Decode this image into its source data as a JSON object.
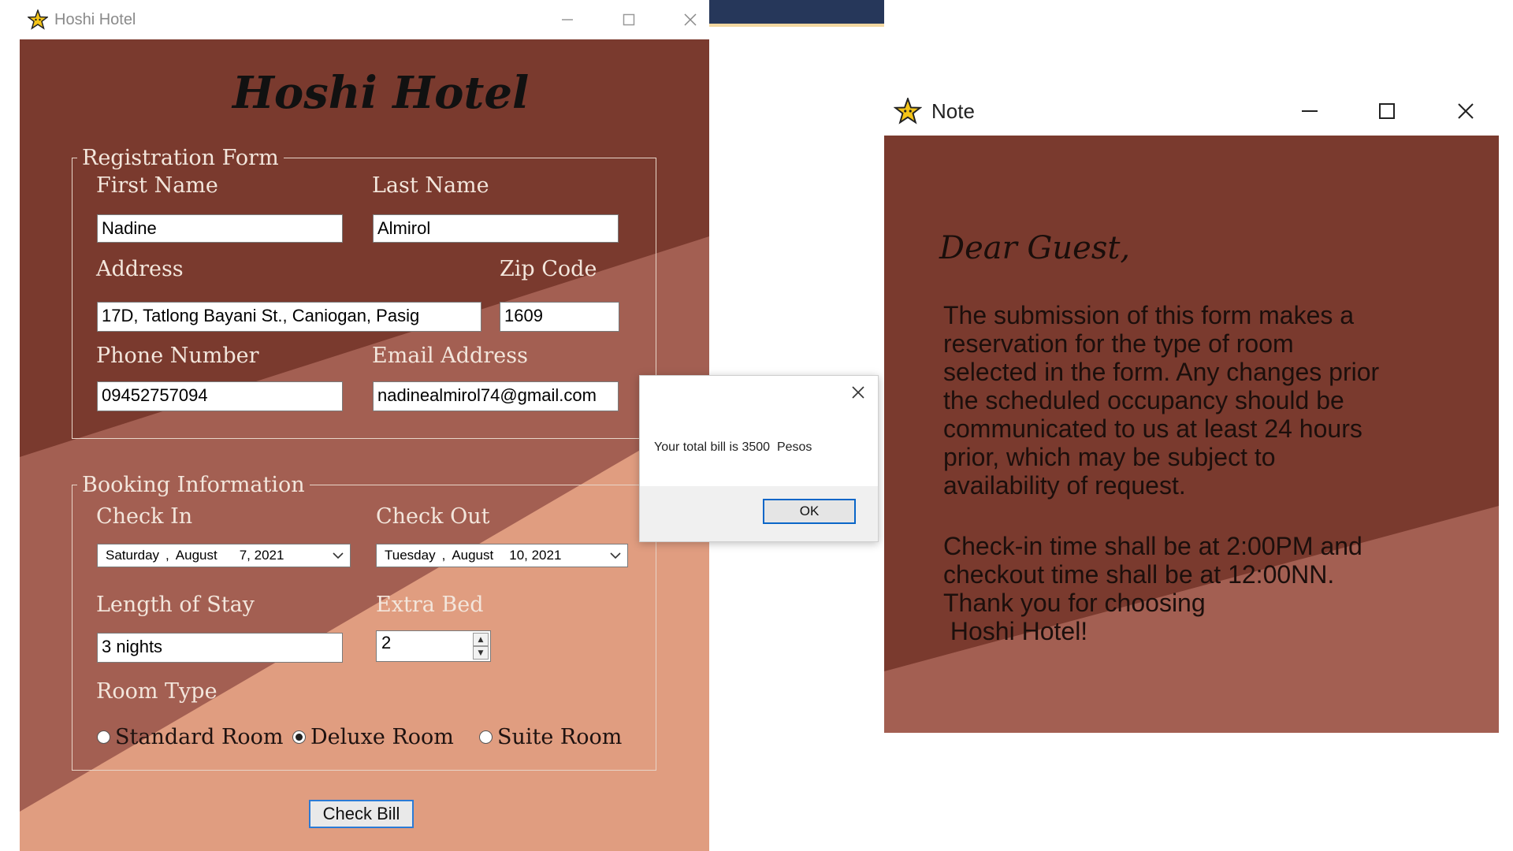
{
  "colors": {
    "dark_brown": "#7a3a2e",
    "mid_brown": "#a35f52",
    "peach": "#e09d80",
    "button_border": "#2b7bd6"
  },
  "main_window": {
    "title": "Hoshi Hotel",
    "icon": "star-icon",
    "heading": "Hoshi Hotel",
    "registration": {
      "legend": "Registration Form",
      "first_name_label": "First Name",
      "first_name": "Nadine",
      "last_name_label": "Last Name",
      "last_name": "Almirol",
      "address_label": "Address",
      "address": "17D, Tatlong Bayani St., Caniogan, Pasig",
      "zip_label": "Zip Code",
      "zip": "1609",
      "phone_label": "Phone Number",
      "phone": "09452757094",
      "email_label": "Email Address",
      "email": "nadinealmirol74@gmail.com"
    },
    "booking": {
      "legend": "Booking Information",
      "check_in_label": "Check In",
      "check_in": {
        "weekday": "Saturday",
        "month": "August",
        "day_year": "7, 2021"
      },
      "check_out_label": "Check Out",
      "check_out": {
        "weekday": "Tuesday",
        "month": "August",
        "day_year": "10, 2021"
      },
      "length_label": "Length of Stay",
      "length": "3 nights",
      "extra_bed_label": "Extra Bed",
      "extra_bed": "2",
      "room_type_label": "Room Type",
      "rooms": [
        "Standard Room",
        "Deluxe Room",
        "Suite Room"
      ],
      "selected_room": "Deluxe Room"
    },
    "check_bill_label": "Check Bill"
  },
  "dialog": {
    "message": "Your total bill is 3500  Pesos",
    "ok_label": "OK"
  },
  "note_window": {
    "title": "Note",
    "icon": "star-icon",
    "greeting": "Dear Guest,",
    "paragraph1": "The submission of this form makes a\nreservation for the type of room\nselected in the form. Any changes prior\nthe scheduled occupancy should be\ncommunicated to us at least 24 hours\nprior, which may be subject to\navailability of request.",
    "paragraph2": "Check-in time shall be at 2:00PM and\ncheckout time shall be at 12:00NN.\nThank you for choosing\n Hoshi Hotel!"
  }
}
